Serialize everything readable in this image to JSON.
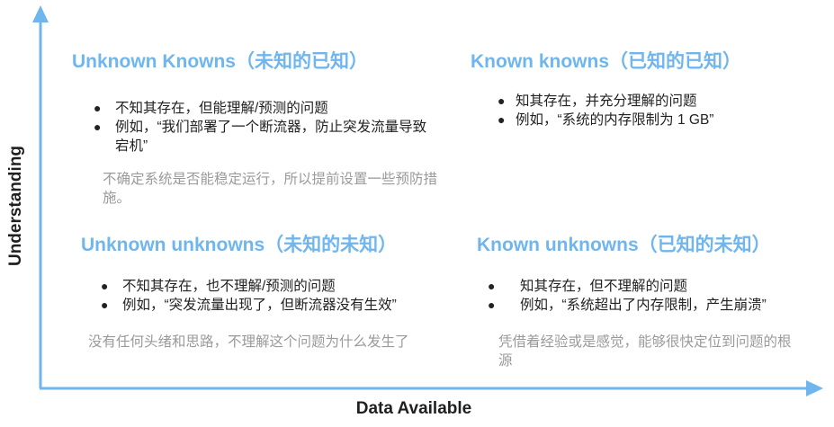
{
  "axes": {
    "y_label": "Understanding",
    "x_label": "Data Available",
    "color": "#6fb6ee"
  },
  "quadrants": {
    "top_left": {
      "title": "Unknown Knowns（未知的已知）",
      "bullets": [
        "不知其存在，但能理解/预测的问题",
        "例如，“我们部署了一个断流器，防止突发流量导致宕机”"
      ],
      "note": "不确定系统是否能稳定运行，所以提前设置一些预防措施。"
    },
    "top_right": {
      "title": "Known knowns（已知的已知）",
      "bullets": [
        "知其存在，并充分理解的问题",
        "例如，“系统的内存限制为 1 GB”"
      ],
      "note": ""
    },
    "bottom_left": {
      "title": "Unknown unknowns（未知的未知）",
      "bullets": [
        "不知其存在，也不理解/预测的问题",
        "例如，“突发流量出现了，但断流器没有生效”"
      ],
      "note": "没有任何头绪和思路，不理解这个问题为什么发生了"
    },
    "bottom_right": {
      "title": "Known unknowns（已知的未知）",
      "bullets": [
        "知其存在，但不理解的问题",
        "例如，“系统超出了内存限制，产生崩溃”"
      ],
      "note": "凭借着经验或是感觉，能够很快定位到问题的根源"
    }
  },
  "bullet_symbol": "●",
  "title_color": "#6fb6ee",
  "note_color": "#9a9a9a"
}
